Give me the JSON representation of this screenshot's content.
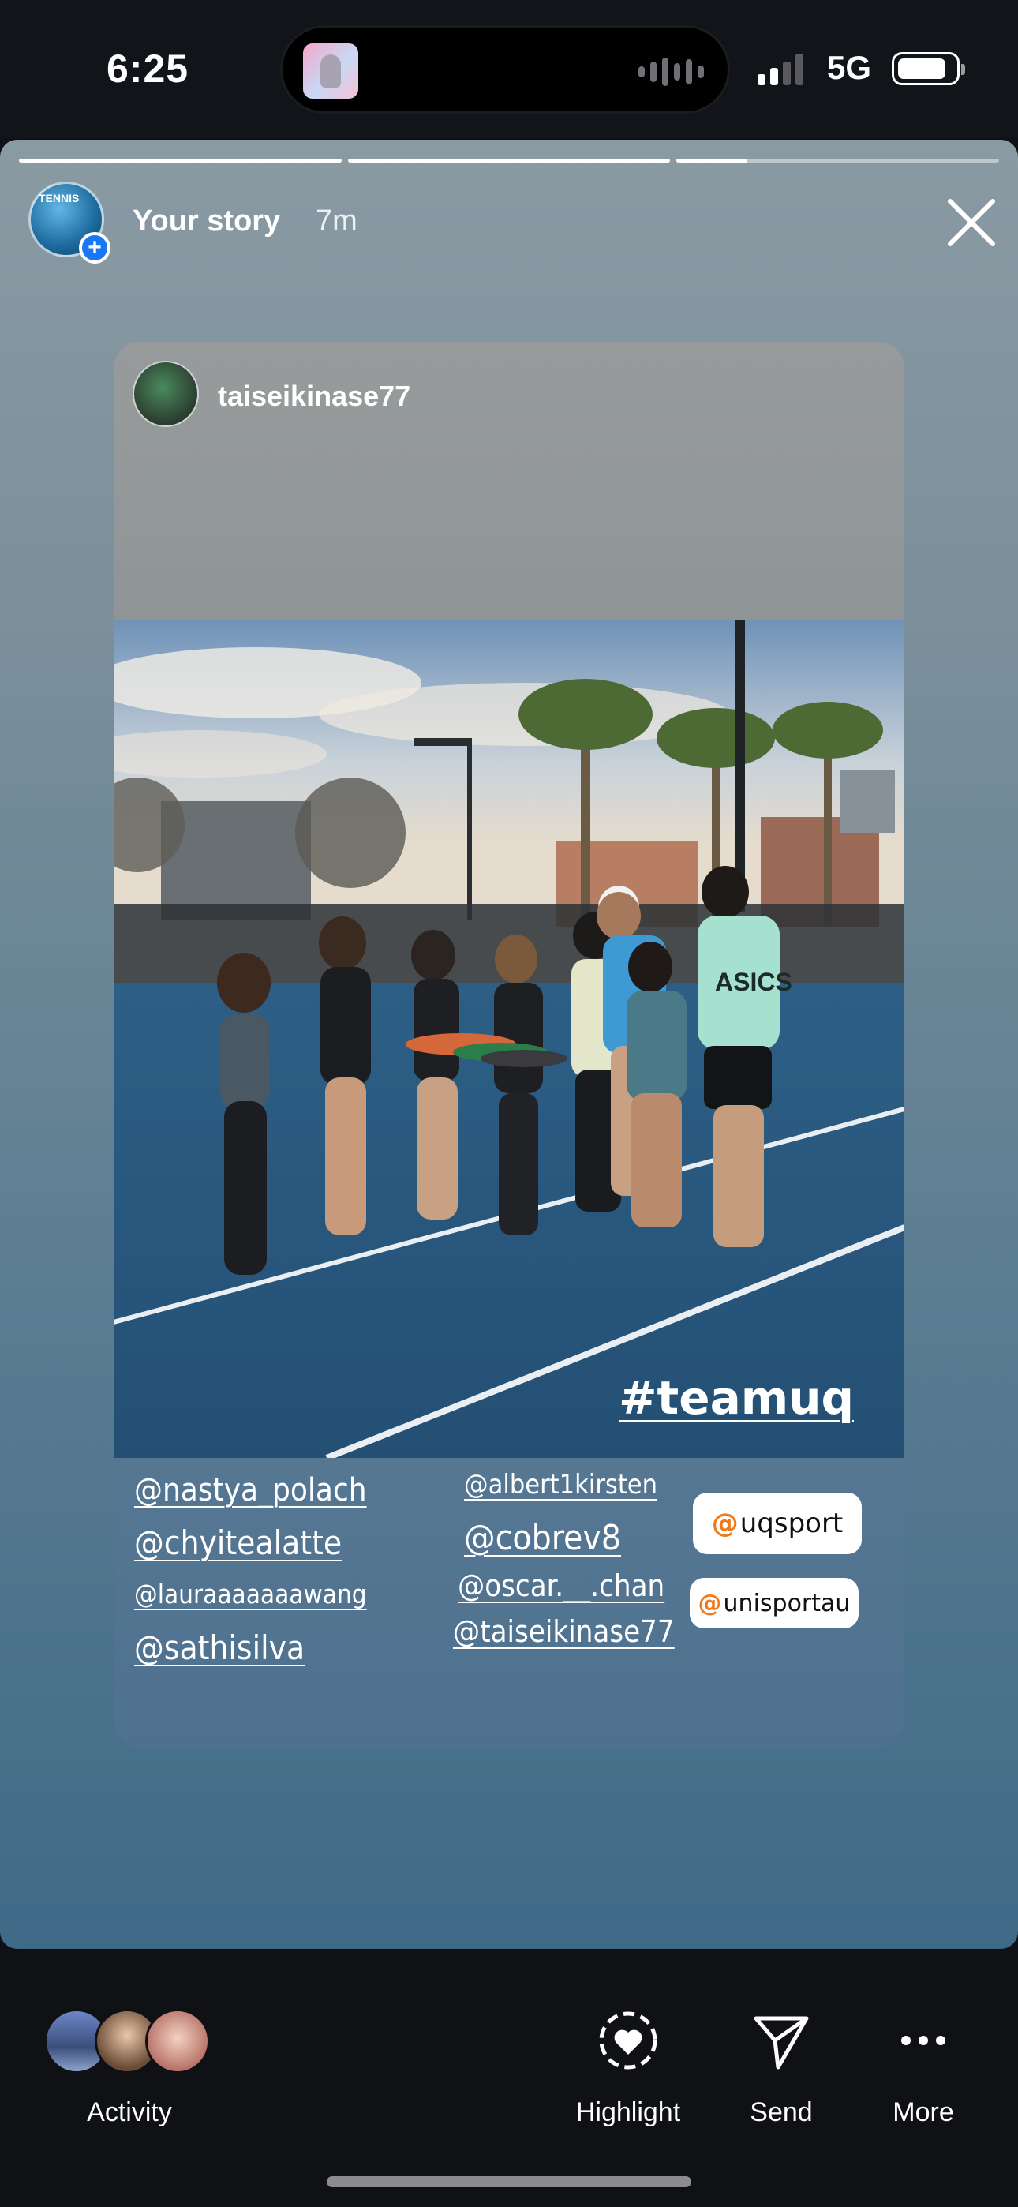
{
  "status_bar": {
    "time": "6:25",
    "network": "5G"
  },
  "story": {
    "progress": [
      1,
      1,
      0.22
    ],
    "user": "Your story",
    "time_ago": "7m",
    "avatar_text": "TENNIS"
  },
  "post": {
    "username": "taiseikinase77",
    "hashtag": "#teamuq",
    "mentions_left": [
      "@nastya_polach",
      "@chyitealatte",
      "@lauraaaaaaawang",
      "@sathisilva"
    ],
    "mentions_middle": [
      "@albert1kirsten",
      "@cobrev8",
      "@oscar.__.chan",
      "@taiseikinase77"
    ],
    "chips": [
      {
        "at": "@",
        "name": "uqsport"
      },
      {
        "at": "@",
        "name": "unisportau"
      }
    ],
    "photo_text": {
      "shirt_logo": "ASICS"
    }
  },
  "bottom_bar": {
    "activity_label": "Activity",
    "highlight_label": "Highlight",
    "send_label": "Send",
    "more_label": "More"
  }
}
